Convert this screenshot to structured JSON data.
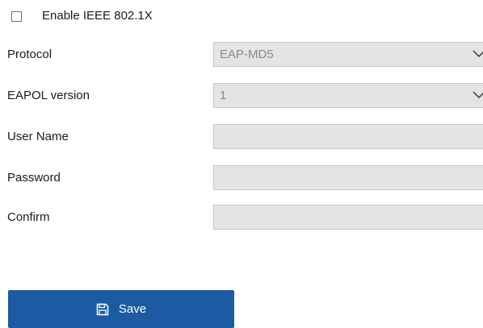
{
  "enable": {
    "label": "Enable IEEE 802.1X",
    "checked": false
  },
  "fields": {
    "protocol": {
      "label": "Protocol",
      "value": "EAP-MD5"
    },
    "eapol_version": {
      "label": "EAPOL version",
      "value": "1"
    },
    "user_name": {
      "label": "User Name",
      "value": ""
    },
    "password": {
      "label": "Password",
      "value": ""
    },
    "confirm": {
      "label": "Confirm",
      "value": ""
    }
  },
  "save": {
    "label": "Save",
    "icon": "floppy-disk-icon",
    "color": "#1c5aa4"
  }
}
